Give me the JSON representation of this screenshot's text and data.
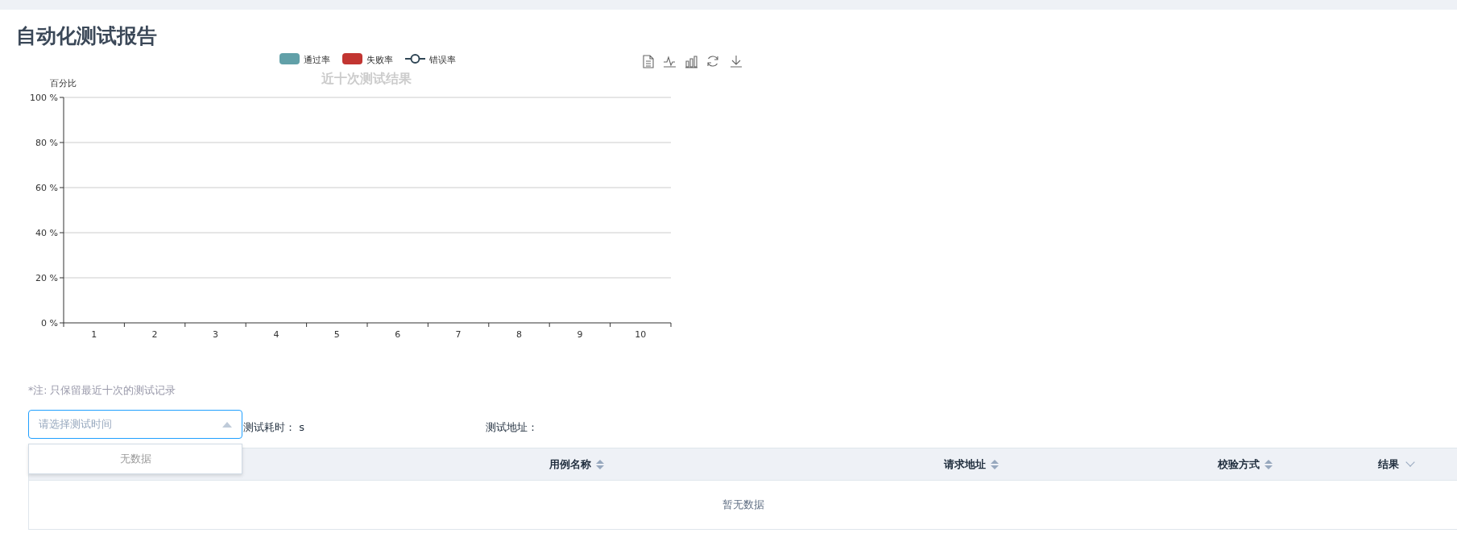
{
  "page_title": "自动化测试报告",
  "chart": {
    "chart_data": {
      "type": "bar",
      "title": "近十次测试结果",
      "ylabel": "百分比",
      "categories": [
        "1",
        "2",
        "3",
        "4",
        "5",
        "6",
        "7",
        "8",
        "9",
        "10"
      ],
      "series": [
        {
          "name": "通过率",
          "type": "bar",
          "color": "#61a0a8",
          "values": [
            null,
            null,
            null,
            null,
            null,
            null,
            null,
            null,
            null,
            null
          ]
        },
        {
          "name": "失败率",
          "type": "bar",
          "color": "#c23531",
          "values": [
            null,
            null,
            null,
            null,
            null,
            null,
            null,
            null,
            null,
            null
          ]
        },
        {
          "name": "错误率",
          "type": "line",
          "color": "#2f4554",
          "values": [
            null,
            null,
            null,
            null,
            null,
            null,
            null,
            null,
            null,
            null
          ]
        }
      ],
      "ylim": [
        0,
        100
      ],
      "grid": true,
      "yticks": [
        {
          "value": 0,
          "label": "0 %"
        },
        {
          "value": 20,
          "label": "20 %"
        },
        {
          "value": 40,
          "label": "40 %"
        },
        {
          "value": 60,
          "label": "60 %"
        },
        {
          "value": 80,
          "label": "80 %"
        },
        {
          "value": 100,
          "label": "100 %"
        }
      ]
    }
  },
  "note": "*注: 只保留最近十次的测试记录",
  "time_select": {
    "placeholder": "请选择测试时间",
    "expanded": true,
    "empty_text": "无数据"
  },
  "duration": {
    "label": "测试耗时：",
    "value": "s"
  },
  "address": {
    "label": "测试地址："
  },
  "table": {
    "columns": [
      {
        "label": "用例名称",
        "kind": "sort"
      },
      {
        "label": "请求地址",
        "kind": "sort"
      },
      {
        "label": "校验方式",
        "kind": "sort"
      },
      {
        "label": "结果",
        "kind": "filter"
      }
    ],
    "empty_text": "暂无数据"
  }
}
